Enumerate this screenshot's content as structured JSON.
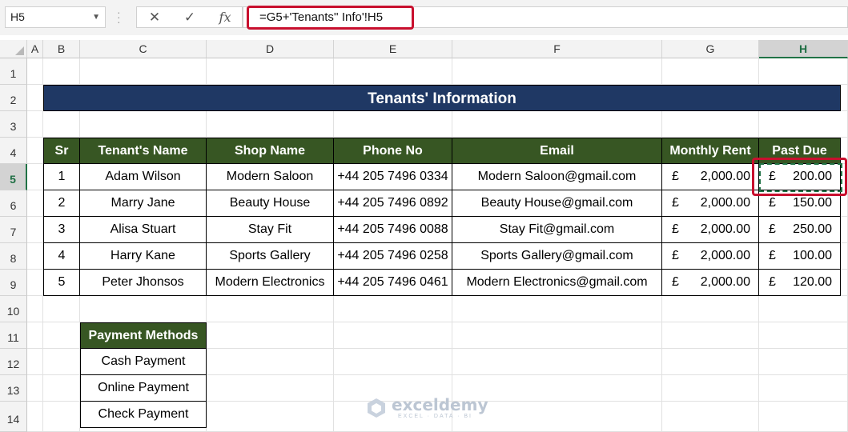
{
  "formula_bar": {
    "name_box": "H5",
    "cancel_icon": "✕",
    "enter_icon": "✓",
    "fx_label": "fx",
    "formula": "=G5+'Tenants'' Info'!H5"
  },
  "columns": [
    "A",
    "B",
    "C",
    "D",
    "E",
    "F",
    "G",
    "H"
  ],
  "rows": [
    "1",
    "2",
    "3",
    "4",
    "5",
    "6",
    "7",
    "8",
    "9",
    "10",
    "11",
    "12",
    "13",
    "14"
  ],
  "selected_cell": "H5",
  "title": "Tenants' Information",
  "table": {
    "headers": [
      "Sr",
      "Tenant's Name",
      "Shop Name",
      "Phone No",
      "Email",
      "Monthly Rent",
      "Past Due"
    ],
    "currency_symbol": "£",
    "rows": [
      {
        "sr": "1",
        "name": "Adam Wilson",
        "shop": "Modern Saloon",
        "phone": "+44 205 7496 0334",
        "email": "Modern Saloon@gmail.com",
        "rent": "2,000.00",
        "due": "200.00"
      },
      {
        "sr": "2",
        "name": "Marry Jane",
        "shop": "Beauty House",
        "phone": "+44 205 7496 0892",
        "email": "Beauty House@gmail.com",
        "rent": "2,000.00",
        "due": "150.00"
      },
      {
        "sr": "3",
        "name": "Alisa Stuart",
        "shop": "Stay Fit",
        "phone": "+44 205 7496 0088",
        "email": "Stay Fit@gmail.com",
        "rent": "2,000.00",
        "due": "250.00"
      },
      {
        "sr": "4",
        "name": "Harry Kane",
        "shop": "Sports Gallery",
        "phone": "+44 205 7496 0258",
        "email": "Sports Gallery@gmail.com",
        "rent": "2,000.00",
        "due": "100.00"
      },
      {
        "sr": "5",
        "name": "Peter Jhonsos",
        "shop": "Modern Electronics",
        "phone": "+44 205 7496 0461",
        "email": "Modern Electronics@gmail.com",
        "rent": "2,000.00",
        "due": "120.00"
      }
    ]
  },
  "payment_methods": {
    "header": "Payment Methods",
    "items": [
      "Cash Payment",
      "Online Payment",
      "Check Payment"
    ]
  },
  "watermark": {
    "name": "exceldemy",
    "tagline": "EXCEL · DATA · BI"
  },
  "colors": {
    "title_fill": "#1f3864",
    "header_fill": "#375623",
    "highlight": "#c8102e",
    "selection": "#217346"
  }
}
